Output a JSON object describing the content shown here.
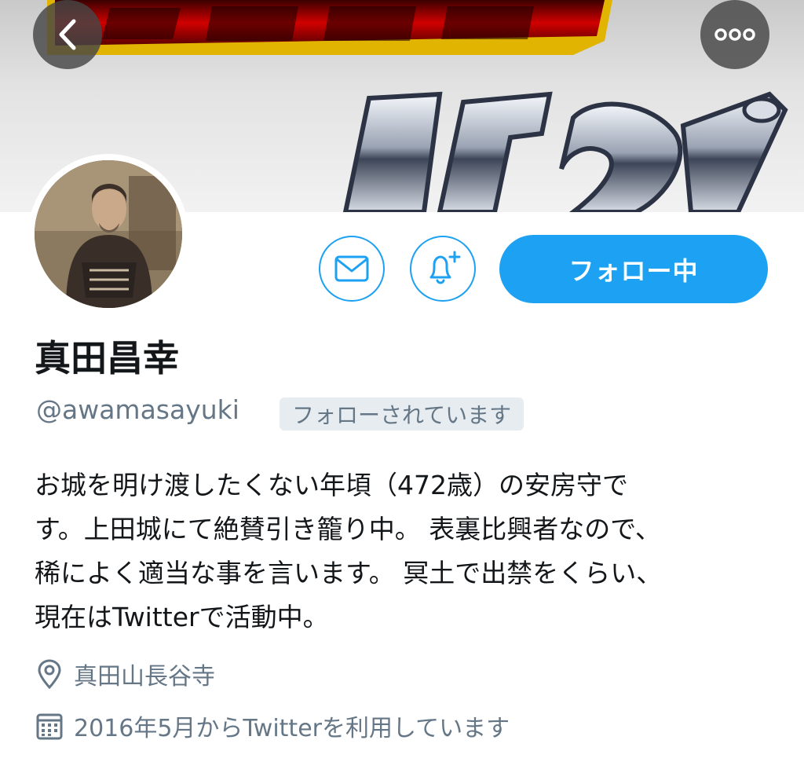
{
  "header": {
    "back_icon": "chevron-left-icon",
    "more_icon": "more-horizontal-icon"
  },
  "actions": {
    "message_icon": "envelope-icon",
    "notify_icon": "bell-plus-icon",
    "follow_label": "フォロー中"
  },
  "profile": {
    "name": "真田昌幸",
    "handle": "@awamasayuki",
    "follows_you": "フォローされています",
    "bio_lines": [
      "お城を明け渡したくない年頃（472歳）の安房守で",
      "す。上田城にて絶賛引き籠り中。 表裏比興者なので、",
      "稀によく適当な事を言います。 冥土で出禁をくらい、",
      "現在はTwitterで活動中。"
    ],
    "location": "真田山長谷寺",
    "joined": "2016年5月からTwitterを利用しています"
  },
  "colors": {
    "accent": "#1da1f2",
    "secondary_text": "#657786",
    "primary_text": "#14171a",
    "badge_bg": "#e6ecf0"
  }
}
